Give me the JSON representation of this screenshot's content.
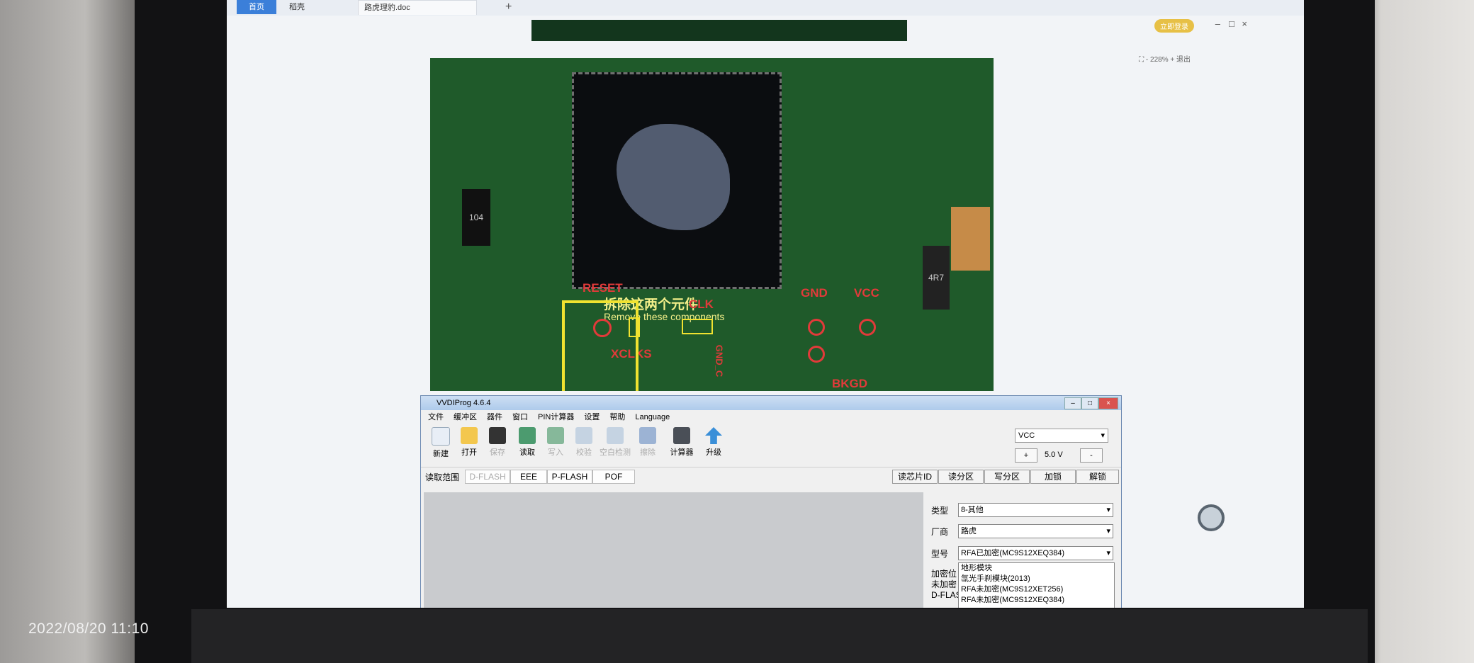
{
  "timestamp": "2022/08/20 11:10",
  "browser": {
    "tabs": [
      "首页",
      "稻壳",
      "路虎理豹.doc"
    ],
    "new_tab": "+",
    "login": "立即登录",
    "zoom": "228%",
    "zoom_out": "-",
    "zoom_in": "+",
    "exit_label": "退出"
  },
  "pcb": {
    "caption_cn": "拆除这两个元件",
    "caption_en": "Remove these components",
    "labels": [
      "RESET",
      "CLK",
      "GND",
      "VCC",
      "XCLKS",
      "BKGD",
      "GND_C"
    ],
    "component_marks": [
      "104",
      "4R7"
    ]
  },
  "app": {
    "title": "VVDIProg 4.6.4",
    "menu": [
      "文件",
      "缓冲区",
      "器件",
      "窗口",
      "PIN计算器",
      "设置",
      "帮助",
      "Language"
    ],
    "toolbar": [
      {
        "label": "新建",
        "enabled": true
      },
      {
        "label": "打开",
        "enabled": true
      },
      {
        "label": "保存",
        "enabled": false
      },
      {
        "label": "读取",
        "enabled": true
      },
      {
        "label": "写入",
        "enabled": false
      },
      {
        "label": "校验",
        "enabled": false
      },
      {
        "label": "空白检测",
        "enabled": false
      },
      {
        "label": "擦除",
        "enabled": false
      },
      {
        "label": "计算器",
        "enabled": true
      },
      {
        "label": "升级",
        "enabled": true
      }
    ],
    "vcc_select": "VCC",
    "voltage": "5.0 V",
    "plus": "+",
    "minus": "-",
    "range_label": "读取范围",
    "range_tabs": [
      "D-FLASH",
      "EEE",
      "P-FLASH",
      "POF"
    ],
    "right_buttons": [
      "读芯片ID",
      "读分区",
      "写分区",
      "加锁",
      "解锁"
    ],
    "type_label": "类型",
    "type_value": "8-其他",
    "vendor_label": "厂商",
    "vendor_value": "路虎",
    "model_label": "型号",
    "model_value": "RFA已加密(MC9S12XEQ384)",
    "dropdown_items": [
      "地形模块",
      "氙光手刹模块(2013)",
      "RFA未加密(MC9S12XET256)",
      "RFA未加密(MC9S12XEQ384)"
    ],
    "left_partial": [
      "加密位",
      "未加密",
      "D-FLAS"
    ]
  }
}
